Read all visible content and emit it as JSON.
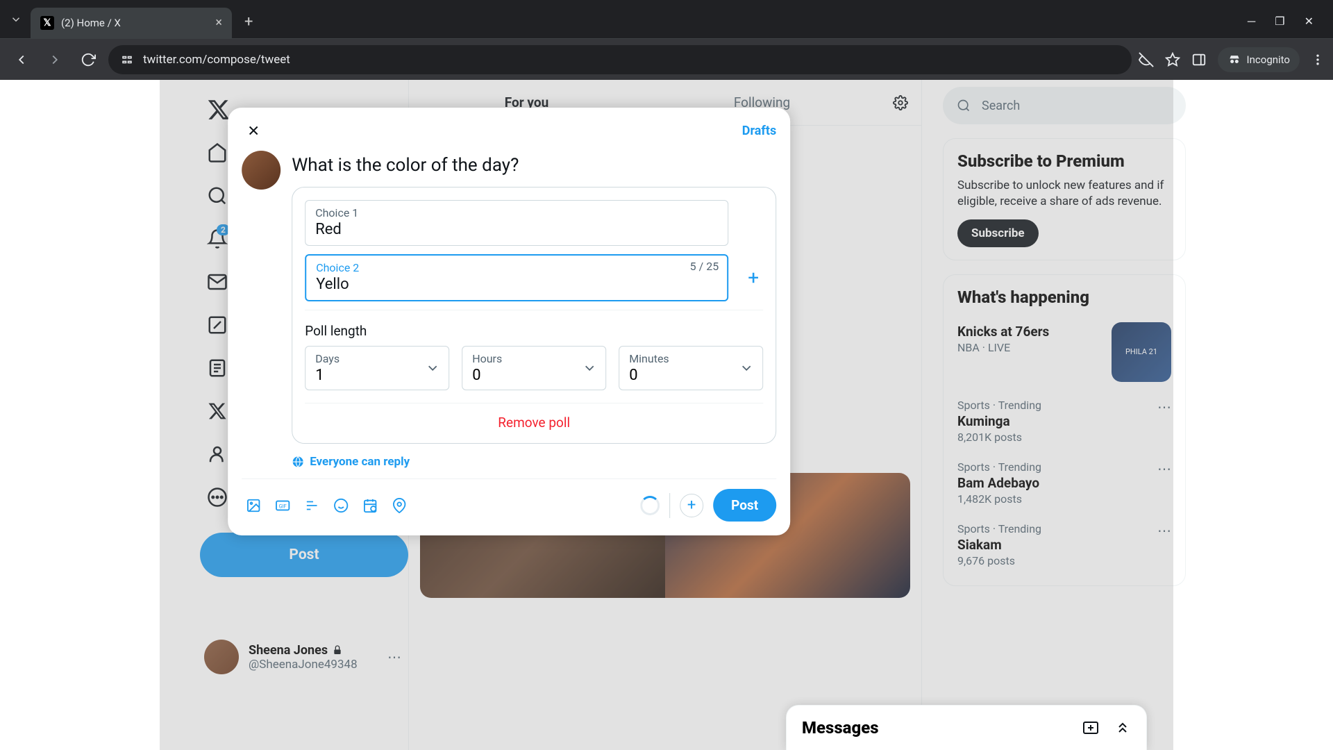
{
  "browser": {
    "tab_title": "(2) Home / X",
    "url": "twitter.com/compose/tweet",
    "incognito_label": "Incognito"
  },
  "sidebar": {
    "items": [
      {
        "label": "Home"
      },
      {
        "label": "Explore"
      },
      {
        "label": "Notifications",
        "badge": "2"
      },
      {
        "label": "Messages"
      },
      {
        "label": "Grok"
      },
      {
        "label": "Lists"
      },
      {
        "label": "Premium"
      },
      {
        "label": "Profile"
      },
      {
        "label": "More"
      }
    ],
    "post_label": "Post",
    "profile": {
      "name": "Sheena Jones",
      "handle": "@SheenaJone49348"
    }
  },
  "main_tabs": {
    "for_you": "For you",
    "following": "Following"
  },
  "search_placeholder": "Search",
  "premium": {
    "title": "Subscribe to Premium",
    "body": "Subscribe to unlock new features and if eligible, receive a share of ads revenue.",
    "cta": "Subscribe"
  },
  "happening": {
    "title": "What's happening",
    "trends": [
      {
        "meta": "NBA · LIVE",
        "title": "Knicks at 76ers",
        "count": ""
      },
      {
        "meta": "Sports · Trending",
        "title": "Kuminga",
        "count": "8,201K posts"
      },
      {
        "meta": "Sports · Trending",
        "title": "Bam Adebayo",
        "count": "1,482K posts"
      },
      {
        "meta": "Sports · Trending",
        "title": "Siakam",
        "count": "9,676 posts"
      }
    ]
  },
  "messages_dock": "Messages",
  "compose": {
    "drafts": "Drafts",
    "question": "What is the color of the day?",
    "choice1_label": "Choice 1",
    "choice1_value": "Red",
    "choice2_label": "Choice 2",
    "choice2_value": "Yello",
    "choice2_counter": "5 / 25",
    "poll_length": "Poll length",
    "days_label": "Days",
    "days_value": "1",
    "hours_label": "Hours",
    "hours_value": "0",
    "minutes_label": "Minutes",
    "minutes_value": "0",
    "remove_poll": "Remove poll",
    "reply_setting": "Everyone can reply",
    "post_label": "Post"
  }
}
